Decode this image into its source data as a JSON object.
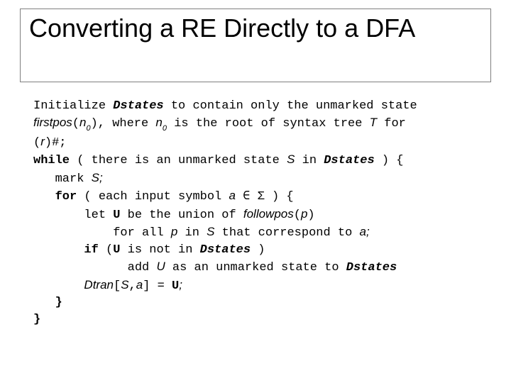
{
  "title": "Converting a RE Directly to a DFA",
  "code": {
    "l1a": "Initialize ",
    "l1b": "Dstates",
    "l1c": " to contain only the unmarked state",
    "l2a": "firstpos",
    "l2b": "(",
    "l2c": "n",
    "l2d": "0",
    "l2e": "), where ",
    "l2f": "n",
    "l2g": "0",
    "l2h": " is the root of syntax tree ",
    "l2i": "T",
    "l2j": " for",
    "l3a": "(",
    "l3b": "r",
    "l3c": ")#;",
    "l4a": "while",
    "l4b": " ( there is an unmarked state ",
    "l4c": "S",
    "l4d": " in ",
    "l4e": "Dstates",
    "l4f": " ) {",
    "l5a": "   mark ",
    "l5b": "S;",
    "l6a": "   ",
    "l6b": "for",
    "l6c": " ( each input symbol ",
    "l6d": "a",
    "l6e": " ∈ Σ ) {",
    "l7a": "       let ",
    "l7b": "U",
    "l7c": " be the union of ",
    "l7d": "followpos",
    "l7e": "(",
    "l7f": "p",
    "l7g": ")",
    "l8a": "           for all ",
    "l8b": "p",
    "l8c": " in ",
    "l8d": "S",
    "l8e": " that correspond to ",
    "l8f": "a;",
    "l9a": "       ",
    "l9b": "if",
    "l9c": " (",
    "l9d": "U",
    "l9e": " is not in ",
    "l9f": "Dstates",
    "l9g": " )",
    "l10a": "             add ",
    "l10b": "U",
    "l10c": " as an unmarked state to ",
    "l10d": "Dstates",
    "l11a": "       ",
    "l11b": "Dtran",
    "l11c": "[",
    "l11d": "S",
    "l11e": ",",
    "l11f": "a",
    "l11g": "] = ",
    "l11h": "U",
    "l11i": ";",
    "l12": "   }",
    "l13": "}"
  }
}
